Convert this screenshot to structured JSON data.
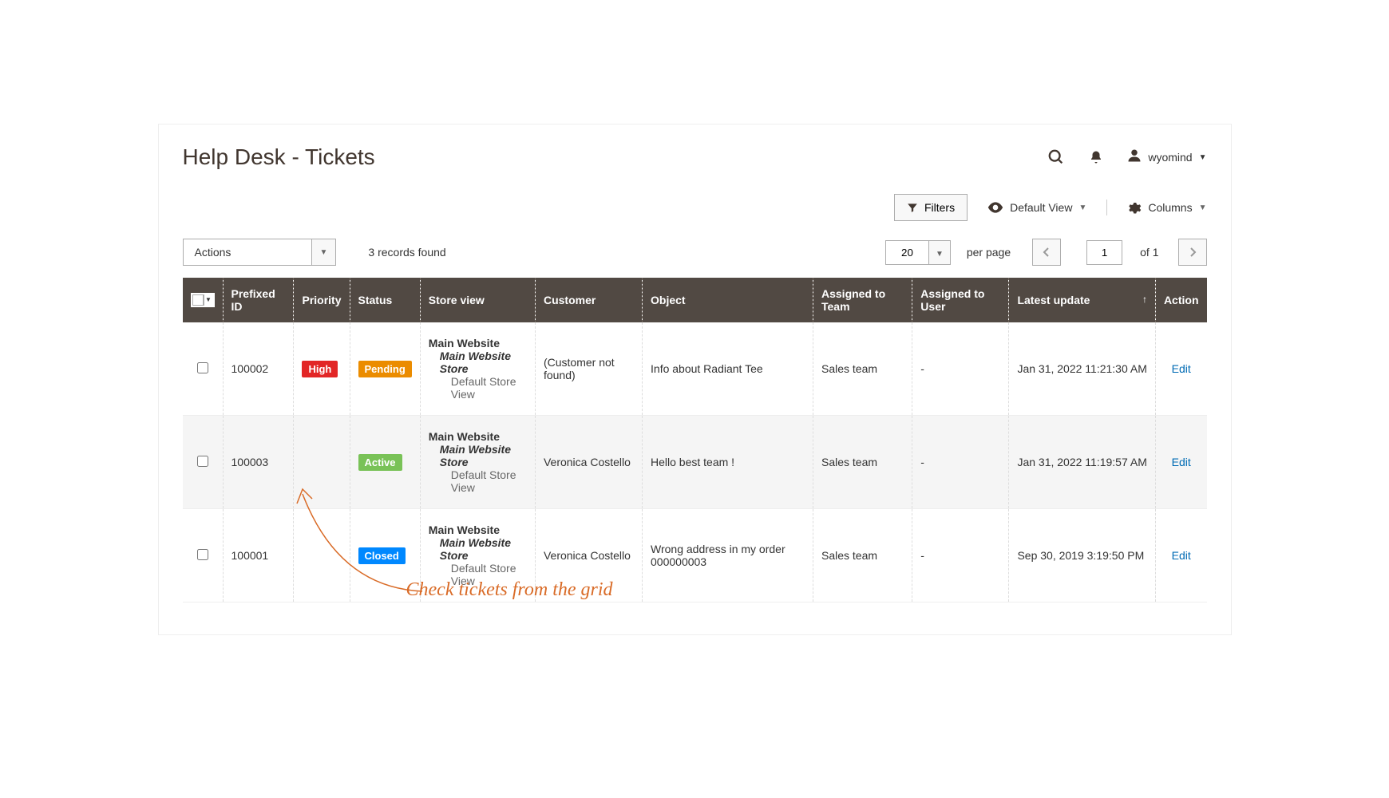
{
  "pageTitle": "Help Desk - Tickets",
  "header": {
    "username": "wyomind"
  },
  "toolbar": {
    "filtersLabel": "Filters",
    "defaultViewLabel": "Default View",
    "columnsLabel": "Columns",
    "actionsLabel": "Actions",
    "recordsFound": "3 records found",
    "pageSize": "20",
    "perPageLabel": "per page",
    "currentPage": "1",
    "totalPagesLabel": "of 1"
  },
  "columns": {
    "prefixedId": "Prefixed ID",
    "priority": "Priority",
    "status": "Status",
    "storeView": "Store view",
    "customer": "Customer",
    "object": "Object",
    "assignedTeam": "Assigned to Team",
    "assignedUser": "Assigned to User",
    "latestUpdate": "Latest update",
    "action": "Action"
  },
  "rows": [
    {
      "prefixedId": "100002",
      "priority": "High",
      "priorityClass": "badge-high",
      "status": "Pending",
      "statusClass": "badge-pending",
      "store1": "Main Website",
      "store2": "Main Website Store",
      "store3": "Default Store View",
      "customer": "(Customer not found)",
      "object": "Info about Radiant Tee",
      "team": "Sales team",
      "user": "-",
      "latest": "Jan 31, 2022 11:21:30 AM",
      "action": "Edit"
    },
    {
      "prefixedId": "100003",
      "priority": "",
      "priorityClass": "",
      "status": "Active",
      "statusClass": "badge-active",
      "store1": "Main Website",
      "store2": "Main Website Store",
      "store3": "Default Store View",
      "customer": "Veronica Costello",
      "object": "Hello best team !",
      "team": "Sales team",
      "user": "-",
      "latest": "Jan 31, 2022 11:19:57 AM",
      "action": "Edit"
    },
    {
      "prefixedId": "100001",
      "priority": "",
      "priorityClass": "",
      "status": "Closed",
      "statusClass": "badge-closed",
      "store1": "Main Website",
      "store2": "Main Website Store",
      "store3": "Default Store View",
      "customer": "Veronica Costello",
      "object": "Wrong address in my order 000000003",
      "team": "Sales team",
      "user": "-",
      "latest": "Sep 30, 2019 3:19:50 PM",
      "action": "Edit"
    }
  ],
  "annotation": "Check tickets from the grid"
}
